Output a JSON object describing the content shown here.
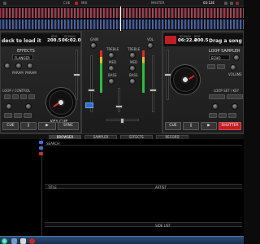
{
  "topbar": {
    "labels": [
      "CUE",
      "MIX",
      "MASTER",
      "03:1E"
    ],
    "brand": "",
    "time": "03:12E"
  },
  "deck_left": {
    "header_text": "deck to load it",
    "bpm_label": "BPM",
    "bpm_value": "200.5",
    "time_label": "REMAIN",
    "time_value": "06:02.0",
    "effects_label": "EFFECTS",
    "effect_select": "FLANGER",
    "params": [
      "PARAM",
      "PARAM"
    ],
    "pitch_label": "PITCH",
    "loop_label": "LOOP / CONTROL",
    "keylock_label": "KEY CUE",
    "sync_label": "SYNC",
    "buttons": [
      "CUE",
      "||",
      "▶",
      "SYNC"
    ]
  },
  "deck_right": {
    "header_text": "Drag a song",
    "bpm_label": "BPM",
    "bpm_value": "200.5",
    "time_label": "REMAIN",
    "time_value": "06:22.4",
    "loop_label": "LOOP SAMPLER",
    "effect_select": "ECHO",
    "volume_label": "VOLUME",
    "loop_length_label": "LOOP SET / KEY",
    "buttons": [
      "CUE",
      "||",
      "▶",
      "SHUTTER"
    ]
  },
  "mixer": {
    "labels": [
      "GAIN",
      "TREBLE",
      "MED",
      "BASS",
      "VOL"
    ],
    "crossfader_label": "XFADE"
  },
  "tabs": [
    "BROWSER",
    "SAMPLER",
    "EFFECTS",
    "RECORD"
  ],
  "active_tab": "BROWSER",
  "browser": {
    "search_label": "SEARCH:",
    "columns": [
      "TITLE",
      "ARTIST"
    ],
    "sidelist_label": "SIDE LIST"
  },
  "colors": {
    "accent_red": "#c01d24",
    "accent_blue": "#2d6fd1",
    "background": "#0b0b0b"
  }
}
